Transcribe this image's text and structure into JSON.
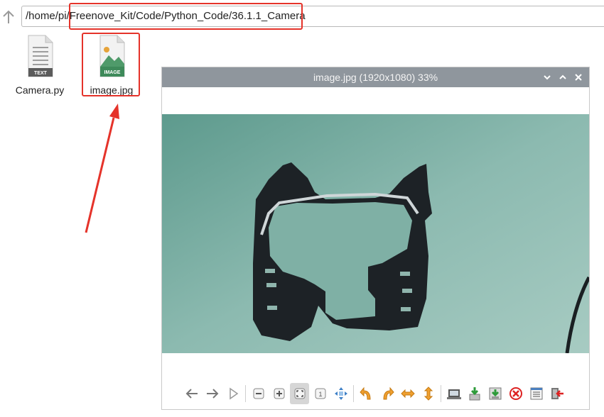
{
  "path_bar": {
    "prefix": "/home/pi/",
    "highlighted": "Freenove_Kit/Code/Python_Code/36.1.1_Camera",
    "up_icon": "arrow-up-icon"
  },
  "files": [
    {
      "name": "Camera.py",
      "badge": "TEXT",
      "icon": "text-file-icon"
    },
    {
      "name": "image.jpg",
      "badge": "IMAGE",
      "icon": "image-file-icon"
    }
  ],
  "viewer": {
    "title": "image.jpg (1920x1080) 33%",
    "window_buttons": [
      "minimize-icon",
      "maximize-icon",
      "close-icon"
    ],
    "toolbar": [
      "previous-icon",
      "next-icon",
      "slideshow-icon",
      "zoom-out-icon",
      "zoom-in-icon",
      "fit-icon",
      "original-size-icon",
      "fullscreen-icon",
      "rotate-left-icon",
      "rotate-right-icon",
      "flip-horizontal-icon",
      "flip-vertical-icon",
      "open-file-icon",
      "save-icon",
      "save-as-icon",
      "delete-icon",
      "preferences-icon",
      "quit-icon"
    ]
  },
  "colors": {
    "highlight": "#e5332a",
    "titlebar": "#8f969d"
  }
}
